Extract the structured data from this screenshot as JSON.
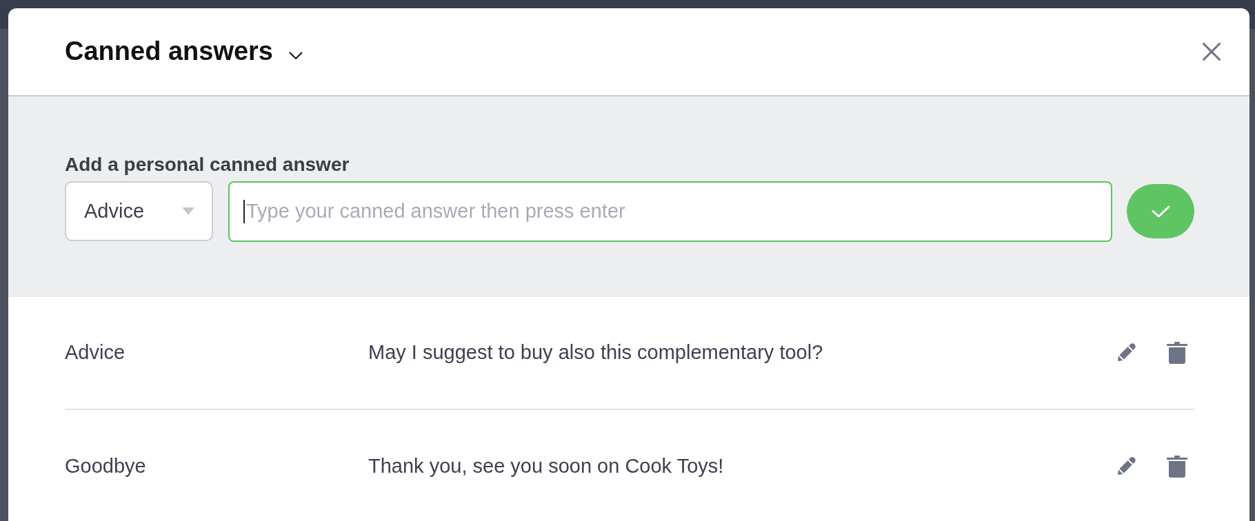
{
  "dialog": {
    "title": "Canned answers"
  },
  "form": {
    "label": "Add a personal canned answer",
    "category": {
      "value": "Advice"
    },
    "answer_field": {
      "placeholder": "Type your canned answer then press enter",
      "focused": true
    }
  },
  "answers": [
    {
      "category": "Advice",
      "text": "May I suggest to buy also this complementary tool?"
    },
    {
      "category": "Goodbye",
      "text": "Thank you, see you soon on Cook Toys!"
    }
  ]
}
